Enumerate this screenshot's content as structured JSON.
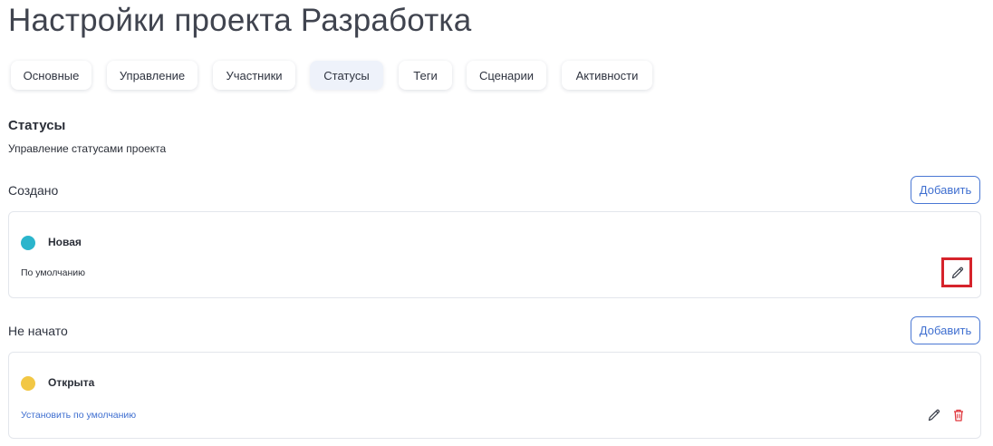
{
  "page": {
    "title": "Настройки проекта Разработка"
  },
  "tabs": [
    {
      "label": "Основные"
    },
    {
      "label": "Управление"
    },
    {
      "label": "Участники"
    },
    {
      "label": "Статусы",
      "active": true
    },
    {
      "label": "Теги"
    },
    {
      "label": "Сценарии"
    },
    {
      "label": "Активности"
    }
  ],
  "section": {
    "title": "Статусы",
    "description": "Управление статусами проекта"
  },
  "groups": [
    {
      "label": "Создано",
      "add_label": "Добавить",
      "status": {
        "name": "Новая",
        "color": "#2bb5cc",
        "note": "По умолчанию",
        "icons": [
          "pencil-icon"
        ]
      }
    },
    {
      "label": "Не начато",
      "add_label": "Добавить",
      "status": {
        "name": "Открыта",
        "color": "#f2c744",
        "link": "Установить по умолчанию",
        "icons": [
          "pencil-icon",
          "trash-icon"
        ]
      }
    }
  ],
  "colors": {
    "accent": "#3f6fd0",
    "danger": "#e0393f",
    "highlight": "#d6232b"
  }
}
